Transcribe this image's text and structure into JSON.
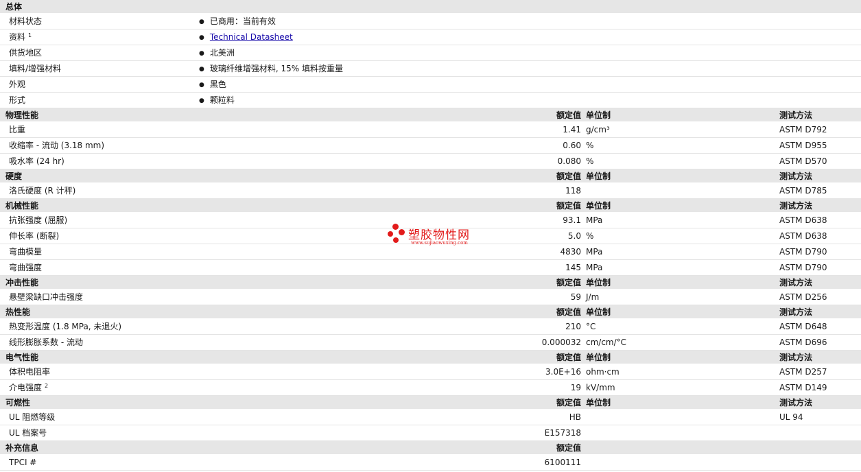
{
  "general": {
    "title": "总体",
    "rows": [
      {
        "name": "材料状态",
        "value": "已商用：当前有效"
      },
      {
        "name": "资料",
        "sup": "1",
        "value": "Technical Datasheet",
        "link": true
      },
      {
        "name": "供货地区",
        "value": "北美洲"
      },
      {
        "name": "填料/增强材料",
        "value": "玻璃纤维增强材料, 15% 填料按重量"
      },
      {
        "name": "外观",
        "value": "黑色"
      },
      {
        "name": "形式",
        "value": "颗粒料"
      }
    ]
  },
  "col_headers": {
    "value": "额定值",
    "unit": "单位制",
    "test": "测试方法"
  },
  "sections": [
    {
      "title": "物理性能",
      "show_unit": true,
      "show_test": true,
      "rows": [
        {
          "name": "比重",
          "value": "1.41",
          "unit": "g/cm³",
          "test": "ASTM D792"
        },
        {
          "name": "收缩率 - 流动 (3.18 mm)",
          "value": "0.60",
          "unit": "%",
          "test": "ASTM D955"
        },
        {
          "name": "吸水率 (24 hr)",
          "value": "0.080",
          "unit": "%",
          "test": "ASTM D570"
        }
      ]
    },
    {
      "title": "硬度",
      "show_unit": true,
      "show_test": true,
      "rows": [
        {
          "name": "洛氏硬度 (R 计秤)",
          "value": "118",
          "unit": "",
          "test": "ASTM D785"
        }
      ]
    },
    {
      "title": "机械性能",
      "show_unit": true,
      "show_test": true,
      "rows": [
        {
          "name": "抗张强度 (屈服)",
          "value": "93.1",
          "unit": "MPa",
          "test": "ASTM D638"
        },
        {
          "name": "伸长率 (断裂)",
          "value": "5.0",
          "unit": "%",
          "test": "ASTM D638"
        },
        {
          "name": "弯曲模量",
          "value": "4830",
          "unit": "MPa",
          "test": "ASTM D790"
        },
        {
          "name": "弯曲强度",
          "value": "145",
          "unit": "MPa",
          "test": "ASTM D790"
        }
      ]
    },
    {
      "title": "冲击性能",
      "show_unit": true,
      "show_test": true,
      "rows": [
        {
          "name": "悬壁梁缺口冲击强度",
          "value": "59",
          "unit": "J/m",
          "test": "ASTM D256"
        }
      ]
    },
    {
      "title": "热性能",
      "show_unit": true,
      "show_test": true,
      "rows": [
        {
          "name": "热变形温度 (1.8 MPa, 未退火)",
          "value": "210",
          "unit": "°C",
          "test": "ASTM D648"
        },
        {
          "name": "线形膨胀系数 - 流动",
          "value": "0.000032",
          "unit": "cm/cm/°C",
          "test": "ASTM D696"
        }
      ]
    },
    {
      "title": "电气性能",
      "show_unit": true,
      "show_test": true,
      "rows": [
        {
          "name": "体积电阻率",
          "value": "3.0E+16",
          "unit": "ohm·cm",
          "test": "ASTM D257"
        },
        {
          "name": "介电强度",
          "sup": "2",
          "value": "19",
          "unit": "kV/mm",
          "test": "ASTM D149"
        }
      ]
    },
    {
      "title": "可燃性",
      "show_unit": true,
      "show_test": true,
      "rows": [
        {
          "name": "UL 阻燃等级",
          "value": "HB",
          "unit": "",
          "test": "UL 94"
        },
        {
          "name": "UL 档案号",
          "value": "E157318",
          "unit": "",
          "test": ""
        }
      ]
    },
    {
      "title": "补充信息",
      "show_unit": false,
      "show_test": false,
      "rows": [
        {
          "name": "TPCI #",
          "value": "6100111",
          "unit": "",
          "test": ""
        }
      ]
    }
  ],
  "watermark": {
    "text": "塑胶物性网",
    "url": "www.sujiaowuxing.com"
  },
  "colors": {
    "header_bg": "#e6e6e6",
    "link": "#1a0dab",
    "watermark": "#e21b1b"
  }
}
